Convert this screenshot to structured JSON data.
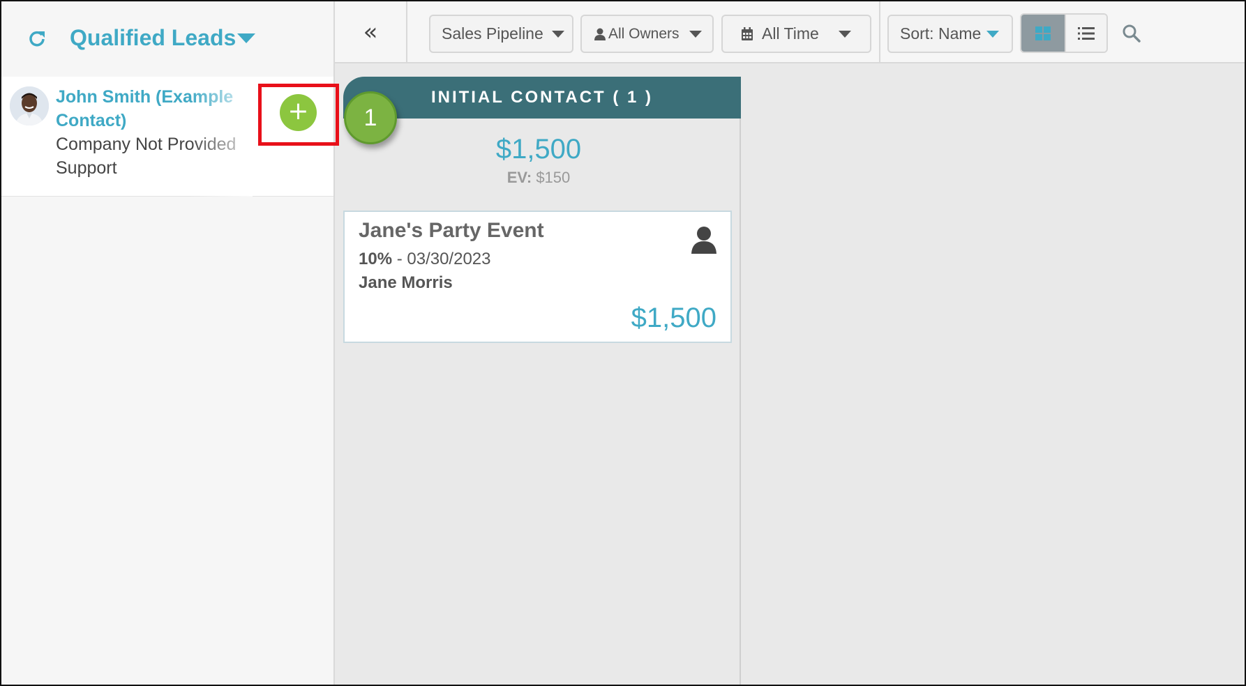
{
  "sidebar": {
    "list_title": "Qualified Leads",
    "contact": {
      "name": "John Smith (Example Contact)",
      "company": "Company Not Provided",
      "department": "Support"
    },
    "add_label": "+"
  },
  "toolbar": {
    "collapse_label": "«",
    "pipeline_label": "Sales Pipeline",
    "owners_label": "All Owners",
    "time_label": "All Time",
    "sort_label": "Sort: Name"
  },
  "column": {
    "header": "INITIAL CONTACT ( 1 )",
    "total": "$1,500",
    "ev_label": "EV:",
    "ev_value": "$150",
    "step_number": "1"
  },
  "deal": {
    "title": "Jane's Party Event",
    "probability": "10%",
    "date_text": " - 03/30/2023",
    "owner": "Jane Morris",
    "value": "$1,500"
  },
  "colors": {
    "accent": "#3fa9c5",
    "header_teal": "#3b6f78",
    "add_green": "#8cc63f",
    "highlight_red": "#e8101a"
  },
  "icons": [
    "refresh-icon",
    "chevron-double-left-icon",
    "user-icon",
    "calendar-icon",
    "grid-view-icon",
    "list-view-icon",
    "search-icon",
    "person-icon"
  ]
}
